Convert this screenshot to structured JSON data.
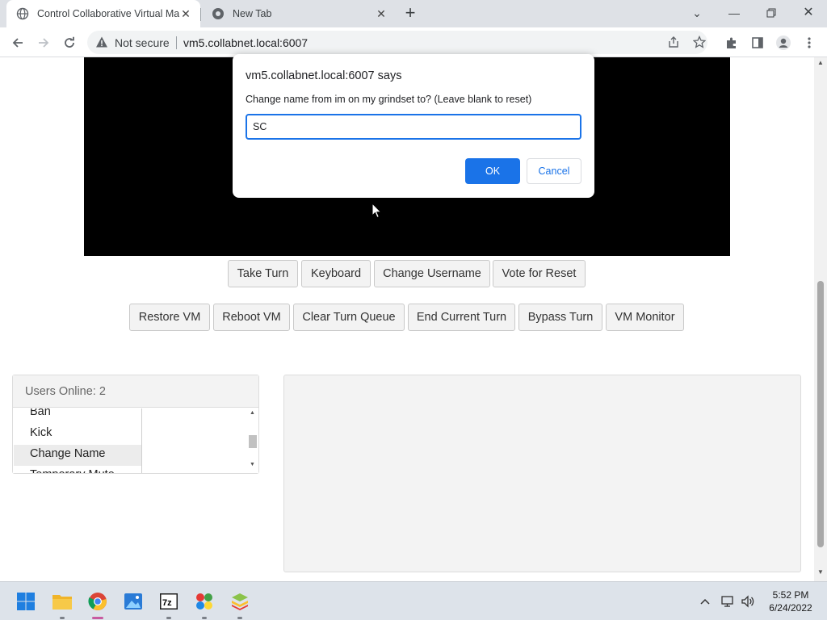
{
  "browser": {
    "tabs": [
      {
        "title": "Control Collaborative Virtual Ma",
        "active": true
      },
      {
        "title": "New Tab",
        "active": false
      }
    ],
    "security_label": "Not secure",
    "url": "vm5.collabnet.local:6007"
  },
  "page": {
    "row1_buttons": [
      "Take Turn",
      "Keyboard",
      "Change Username",
      "Vote for Reset"
    ],
    "row2_buttons": [
      "Restore VM",
      "Reboot VM",
      "Clear Turn Queue",
      "End Current Turn",
      "Bypass Turn",
      "VM Monitor"
    ],
    "users_header": "Users Online: 2",
    "context_menu": [
      "Ban",
      "Kick",
      "Change Name",
      "Temporary Mute"
    ]
  },
  "dialog": {
    "title": "vm5.collabnet.local:6007 says",
    "message": "Change name from im on my grindset to? (Leave blank to reset)",
    "input_value": "SC",
    "ok_label": "OK",
    "cancel_label": "Cancel"
  },
  "taskbar": {
    "apps": [
      "start-icon",
      "file-explorer-icon",
      "chrome-icon",
      "photos-icon",
      "7zip-icon",
      "puzzle-app-icon",
      "bluestacks-icon"
    ],
    "time": "5:52 PM",
    "date": "6/24/2022"
  },
  "colors": {
    "accent": "#1a73e8",
    "vm_screen": "#000000",
    "button_bg": "#f3f3f3",
    "taskbar_bg": "#dde3ea"
  }
}
